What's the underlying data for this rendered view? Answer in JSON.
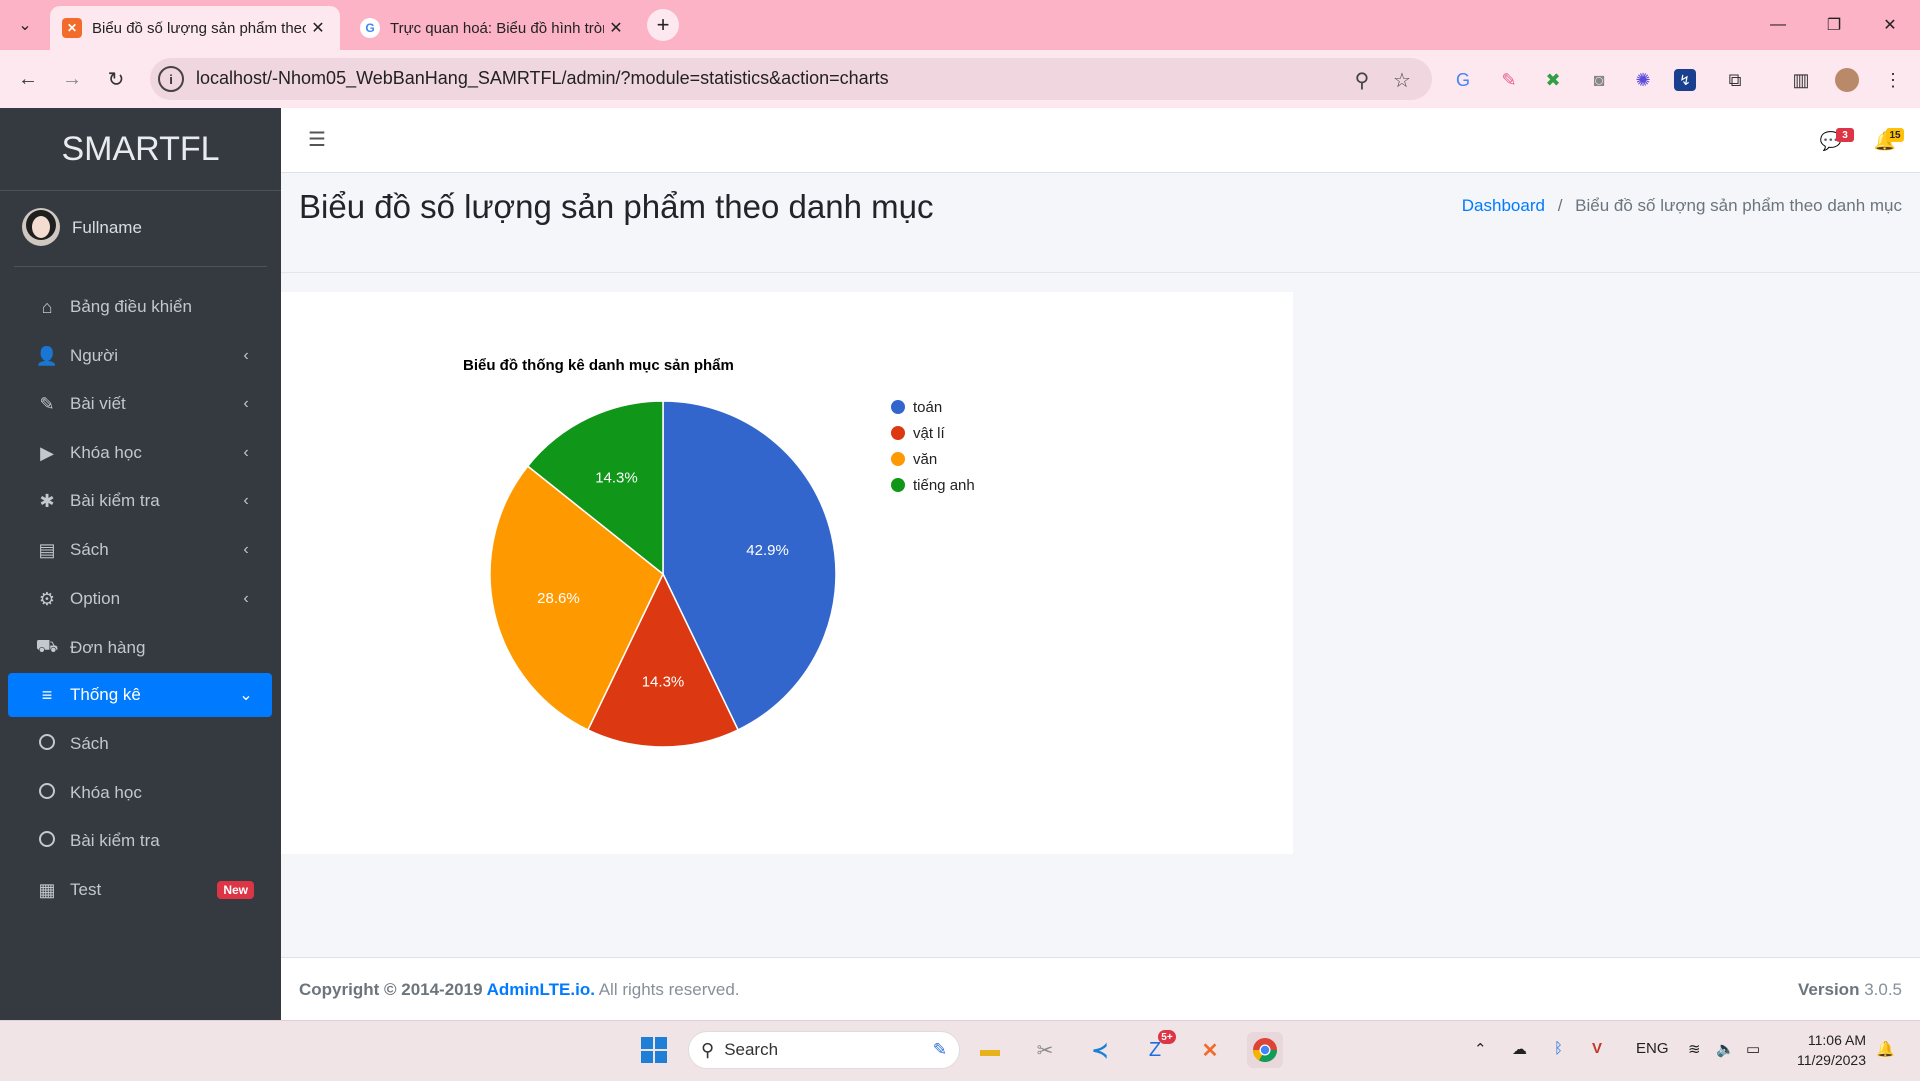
{
  "browser": {
    "tabs": [
      {
        "title": "Biểu đồ số lượng sản phẩm theo danh mục",
        "active": true
      },
      {
        "title": "Trực quan hoá: Biểu đồ hình tròn",
        "active": false
      }
    ],
    "url": "localhost/-Nhom05_WebBanHang_SAMRTFL/admin/?module=statistics&action=charts"
  },
  "sidebar": {
    "brand": "SMARTFL",
    "user": "Fullname",
    "items": [
      {
        "label": "Bảng điều khiển",
        "icon": "home-icon",
        "glyph": "⌂",
        "chevron": ""
      },
      {
        "label": "Người",
        "icon": "user-icon",
        "glyph": "👤",
        "chevron": "‹"
      },
      {
        "label": "Bài viết",
        "icon": "blog-icon",
        "glyph": "✎",
        "chevron": "‹"
      },
      {
        "label": "Khóa học",
        "icon": "video-icon",
        "glyph": "▶",
        "chevron": "‹"
      },
      {
        "label": "Bài kiểm tra",
        "icon": "bug-icon",
        "glyph": "✱",
        "chevron": "‹"
      },
      {
        "label": "Sách",
        "icon": "book-icon",
        "glyph": "▤",
        "chevron": "‹"
      },
      {
        "label": "Option",
        "icon": "gear-icon",
        "glyph": "⚙",
        "chevron": "‹"
      },
      {
        "label": "Đơn hàng",
        "icon": "truck-icon",
        "glyph": "⛟",
        "chevron": ""
      },
      {
        "label": "Thống kê",
        "icon": "chart-icon",
        "glyph": "≡",
        "chevron": "⌄",
        "active": true
      },
      {
        "label": "Sách",
        "icon": "circle-icon",
        "glyph": "",
        "chevron": ""
      },
      {
        "label": "Khóa học",
        "icon": "circle-icon",
        "glyph": "",
        "chevron": ""
      },
      {
        "label": "Bài kiểm tra",
        "icon": "circle-icon",
        "glyph": "",
        "chevron": ""
      },
      {
        "label": "Test",
        "icon": "grid-icon",
        "glyph": "▦",
        "chevron": "",
        "badge": "New"
      }
    ]
  },
  "header": {
    "messages_count": "3",
    "notifications_count": "15"
  },
  "page": {
    "title": "Biểu đồ số lượng sản phẩm theo danh mục",
    "breadcrumb": [
      "Dashboard",
      "Biểu đồ số lượng sản phẩm theo danh mục"
    ]
  },
  "chart_data": {
    "type": "pie",
    "title": "Biểu đồ thống kê danh mục sản phẩm",
    "categories": [
      "toán",
      "vật lí",
      "văn",
      "tiếng anh"
    ],
    "values": [
      42.9,
      14.3,
      28.6,
      14.3
    ],
    "labels": [
      "42.9%",
      "14.3%",
      "28.6%",
      "14.3%"
    ],
    "colors": [
      "#3366cc",
      "#dc3912",
      "#ff9900",
      "#109618"
    ],
    "legend": "right"
  },
  "footer": {
    "copyright_prefix": "Copyright © 2014-2019 ",
    "copyright_link": "AdminLTE.io.",
    "copyright_suffix": " All rights reserved.",
    "version_label": "Version",
    "version": "3.0.5"
  },
  "taskbar": {
    "search_label": "Search",
    "lang": "ENG",
    "time": "11:06 AM",
    "date": "11/29/2023",
    "zalo_badge": "5+"
  }
}
